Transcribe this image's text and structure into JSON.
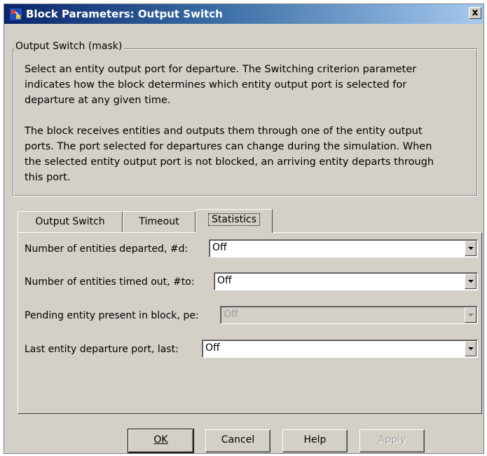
{
  "window": {
    "title": "Block Parameters: Output Switch",
    "close_label": "x"
  },
  "mask": {
    "group_title": "Output Switch (mask)",
    "paragraph1_lines": [
      "Select an entity output port for departure. The Switching criterion parameter",
      "indicates how the block determines which entity output port is selected for",
      "departure at any given time."
    ],
    "paragraph2_lines": [
      "The block receives entities and outputs them through one of the entity output",
      "ports. The port selected for departures can change during the simulation. When",
      "the selected entity output port is not blocked, an arriving entity departs through",
      "this port."
    ]
  },
  "tabs": [
    {
      "label": "Output Switch",
      "active": false
    },
    {
      "label": "Timeout",
      "active": false
    },
    {
      "label": "Statistics",
      "active": true
    }
  ],
  "statistics": {
    "rows": [
      {
        "label": "Number of entities departed, #d:",
        "value": "Off",
        "enabled": true
      },
      {
        "label": "Number of entities timed out, #to:",
        "value": "Off",
        "enabled": true
      },
      {
        "label": "Pending entity present in block, pe:",
        "value": "Off",
        "enabled": false
      },
      {
        "label": "Last entity departure port, last:",
        "value": "Off",
        "enabled": true
      }
    ]
  },
  "buttons": {
    "ok": "OK",
    "cancel": "Cancel",
    "help": "Help",
    "apply": "Apply"
  },
  "colors": {
    "dialog_bg": "#d4d0c8",
    "titlebar_start": "#0a246a",
    "titlebar_end": "#a6caf0"
  }
}
